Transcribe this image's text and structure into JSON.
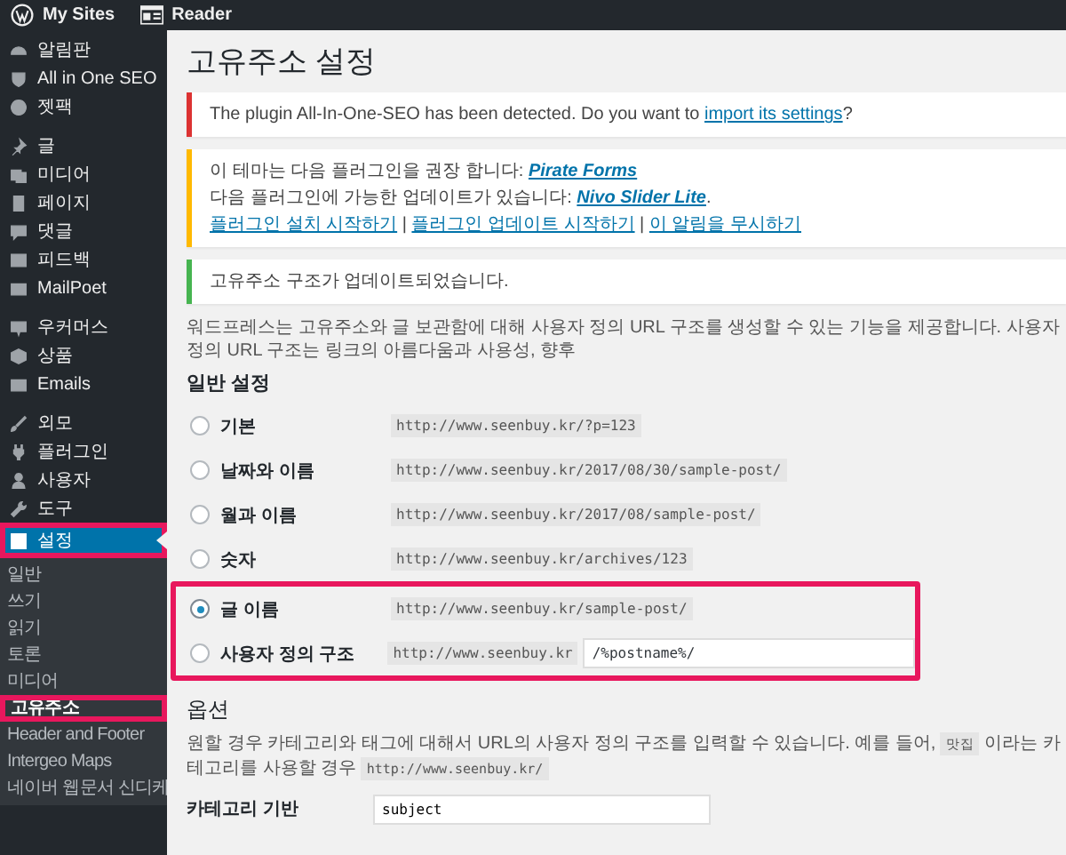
{
  "admin_bar": {
    "items": [
      {
        "label": "My Sites"
      },
      {
        "label": "Reader"
      }
    ]
  },
  "sidebar": {
    "groups": [
      {
        "items": [
          {
            "label": "알림판",
            "selected": false,
            "highlighted": false
          },
          {
            "label": "All in One SEO",
            "selected": false,
            "highlighted": false
          },
          {
            "label": "젯팩",
            "selected": false,
            "highlighted": false
          }
        ]
      },
      {
        "items": [
          {
            "label": "글",
            "selected": false,
            "highlighted": false
          },
          {
            "label": "미디어",
            "selected": false,
            "highlighted": false
          },
          {
            "label": "페이지",
            "selected": false,
            "highlighted": false
          },
          {
            "label": "댓글",
            "selected": false,
            "highlighted": false
          },
          {
            "label": "피드백",
            "selected": false,
            "highlighted": false
          },
          {
            "label": "MailPoet",
            "selected": false,
            "highlighted": false
          }
        ]
      },
      {
        "items": [
          {
            "label": "우커머스",
            "selected": false,
            "highlighted": false
          },
          {
            "label": "상품",
            "selected": false,
            "highlighted": false
          },
          {
            "label": "Emails",
            "selected": false,
            "highlighted": false
          }
        ]
      },
      {
        "items": [
          {
            "label": "외모",
            "selected": false,
            "highlighted": false
          },
          {
            "label": "플러그인",
            "selected": false,
            "highlighted": false
          },
          {
            "label": "사용자",
            "selected": false,
            "highlighted": false
          },
          {
            "label": "도구",
            "selected": false,
            "highlighted": false
          },
          {
            "label": "설정",
            "selected": true,
            "highlighted": true,
            "submenu": [
              {
                "label": "일반",
                "selected": false,
                "highlighted": false
              },
              {
                "label": "쓰기",
                "selected": false,
                "highlighted": false
              },
              {
                "label": "읽기",
                "selected": false,
                "highlighted": false
              },
              {
                "label": "토론",
                "selected": false,
                "highlighted": false
              },
              {
                "label": "미디어",
                "selected": false,
                "highlighted": false
              },
              {
                "label": "고유주소",
                "selected": true,
                "highlighted": true
              },
              {
                "label": "Header and Footer",
                "selected": false,
                "highlighted": false
              },
              {
                "label": "Intergeo Maps",
                "selected": false,
                "highlighted": false
              },
              {
                "label": "네이버 웹문서 신디케",
                "selected": false,
                "highlighted": false
              }
            ]
          }
        ]
      }
    ]
  },
  "page": {
    "title": "고유주소 설정",
    "notices": [
      {
        "kind": "error",
        "lines": [
          [
            {
              "kind": "text",
              "text": "The plugin All-In-One-SEO has been detected. Do you want to "
            },
            {
              "kind": "link",
              "text": "import its settings"
            },
            {
              "kind": "text",
              "text": "?"
            }
          ]
        ]
      },
      {
        "kind": "warning",
        "lines": [
          [
            {
              "kind": "text",
              "text": "이 테마는 다음 플러그인을 권장 합니다: "
            },
            {
              "kind": "strong-link",
              "text": "Pirate Forms"
            }
          ],
          [
            {
              "kind": "text",
              "text": "다음 플러그인에 가능한 업데이트가 있습니다: "
            },
            {
              "kind": "strong-link",
              "text": "Nivo Slider Lite"
            },
            {
              "kind": "text",
              "text": "."
            }
          ],
          [
            {
              "kind": "link",
              "text": "플러그인 설치 시작하기"
            },
            {
              "kind": "text",
              "text": " | "
            },
            {
              "kind": "link",
              "text": "플러그인 업데이트 시작하기"
            },
            {
              "kind": "text",
              "text": " | "
            },
            {
              "kind": "link",
              "text": "이 알림을 무시하기"
            }
          ]
        ]
      },
      {
        "kind": "success",
        "lines": [
          [
            {
              "kind": "text",
              "text": "고유주소 구조가 업데이트되었습니다."
            }
          ]
        ]
      }
    ],
    "description": "워드프레스는 고유주소와 글 보관함에 대해 사용자 정의 URL 구조를 생성할 수 있는 기능을 제공합니다. 사용자 정의 URL 구조는 링크의 아름다움과 사용성, 향후",
    "general_heading": "일반 설정",
    "options": [
      {
        "kind": "preset",
        "label": "기본",
        "example": "http://www.seenbuy.kr/?p=123",
        "selected": false,
        "highlighted": false
      },
      {
        "kind": "preset",
        "label": "날짜와 이름",
        "example": "http://www.seenbuy.kr/2017/08/30/sample-post/",
        "selected": false,
        "highlighted": false
      },
      {
        "kind": "preset",
        "label": "월과 이름",
        "example": "http://www.seenbuy.kr/2017/08/sample-post/",
        "selected": false,
        "highlighted": false
      },
      {
        "kind": "preset",
        "label": "숫자",
        "example": "http://www.seenbuy.kr/archives/123",
        "selected": false,
        "highlighted": false
      },
      {
        "kind": "preset",
        "label": "글 이름",
        "example": "http://www.seenbuy.kr/sample-post/",
        "selected": true,
        "highlighted": true
      },
      {
        "kind": "custom",
        "label": "사용자 정의 구조",
        "example": "http://www.seenbuy.kr",
        "value": "/%postname%/",
        "selected": false,
        "highlighted": true
      }
    ],
    "options_heading": "옵션",
    "options_description": [
      {
        "kind": "text",
        "text": "원할 경우 카테고리와 태그에 대해서 URL의 사용자 정의 구조를 입력할 수 있습니다. 예를 들어, "
      },
      {
        "kind": "code",
        "text": "맛집"
      },
      {
        "kind": "text",
        "text": " 이라는 카테고리를 사용할 경우 "
      },
      {
        "kind": "code",
        "text": "http://www.seenbuy.kr/"
      }
    ],
    "fields": [
      {
        "label": "카테고리 기반",
        "value": "subject"
      }
    ]
  }
}
